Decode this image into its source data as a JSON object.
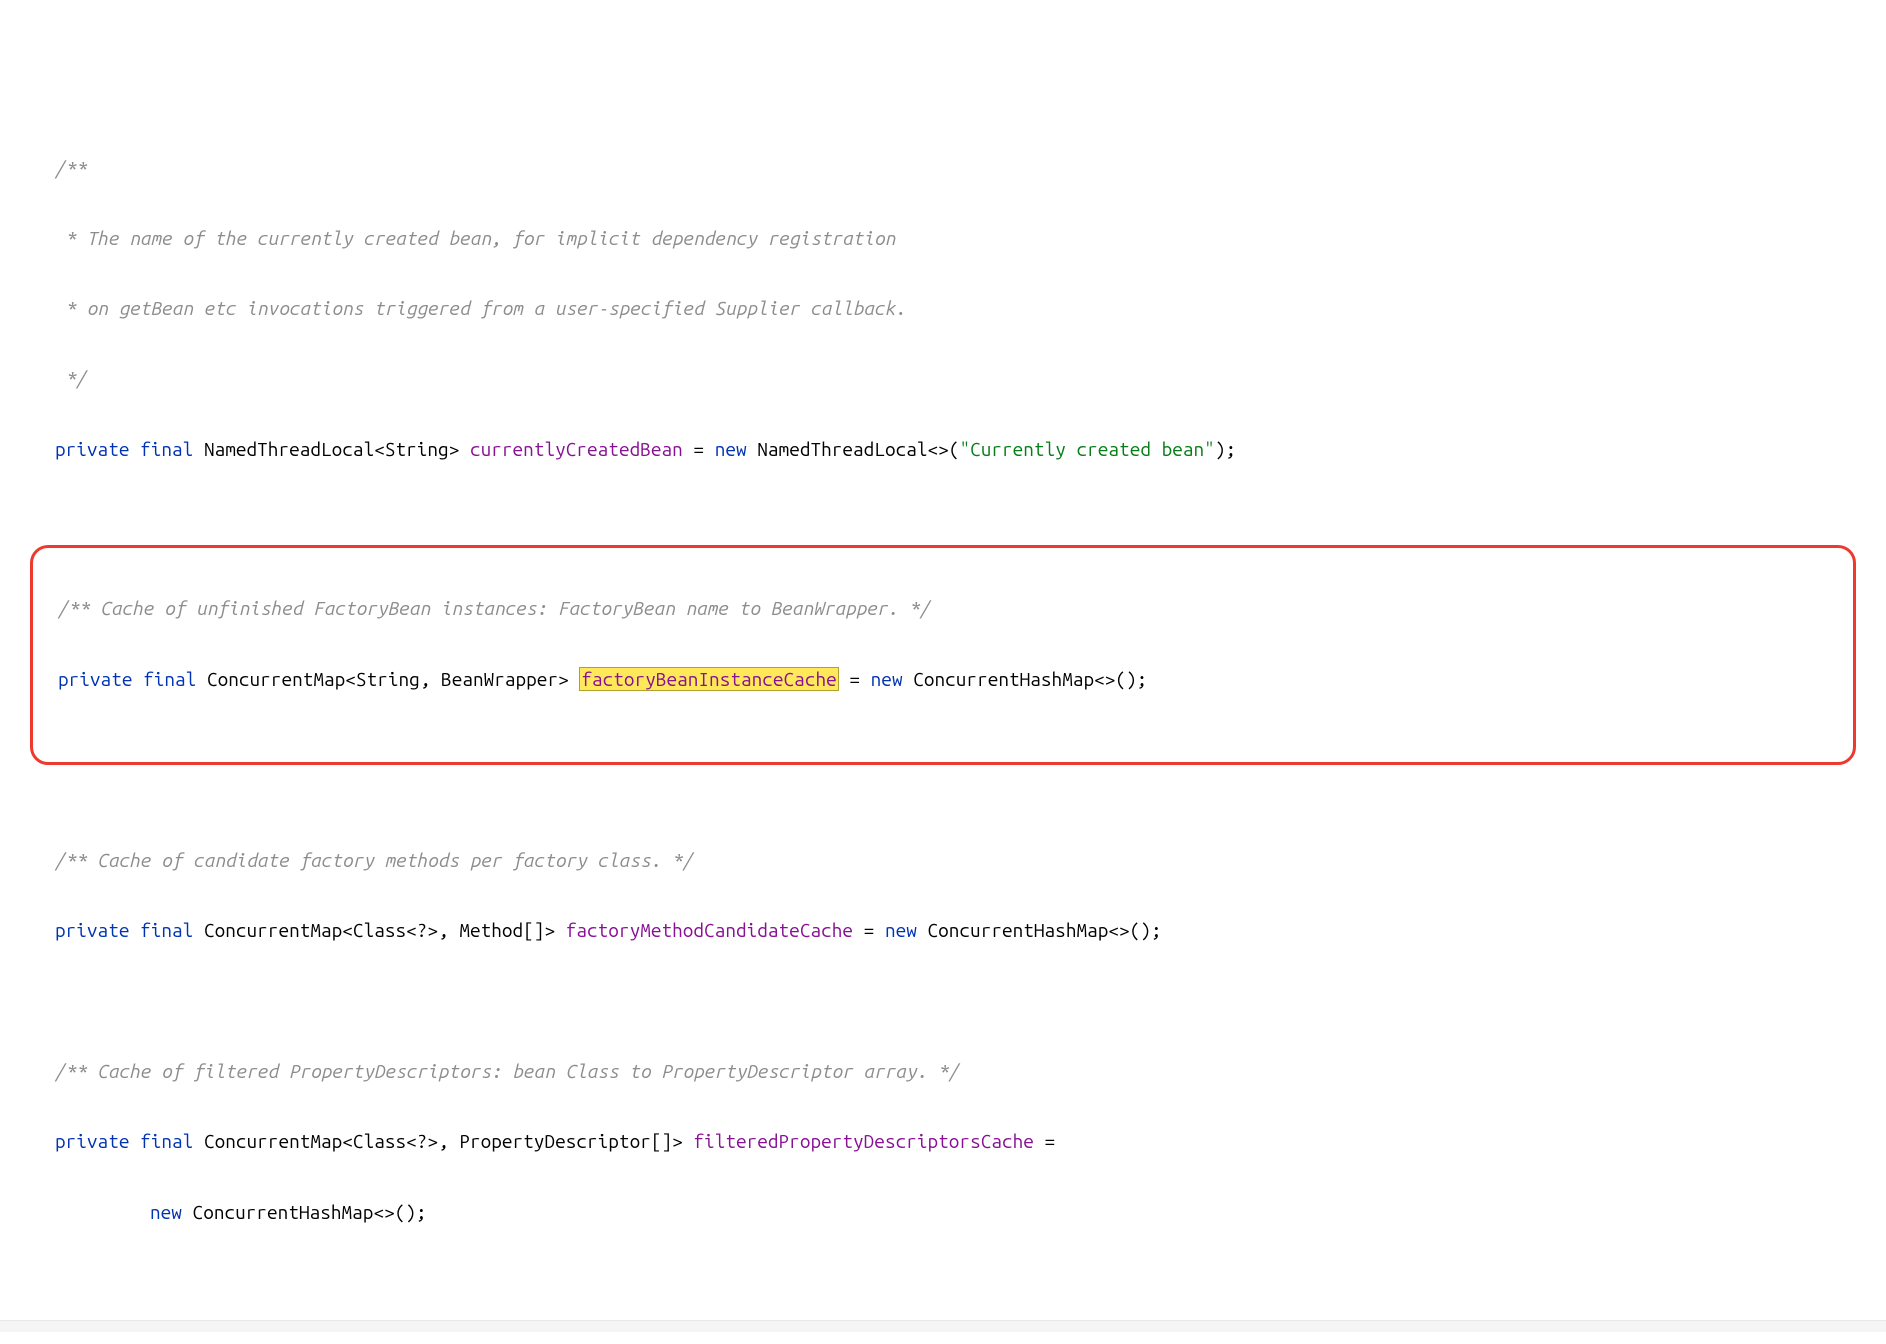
{
  "block1": {
    "c1": "/**",
    "c2": " * The name of the currently created bean, for implicit dependency registration",
    "c3": " * on getBean etc invocations triggered from a user-specified Supplier callback.",
    "c4": " */",
    "kw_private": "private",
    "kw_final": "final",
    "type1": "NamedThreadLocal",
    "gen1": "<String>",
    "field": "currentlyCreatedBean",
    "eq": " = ",
    "kw_new": "new",
    "type2": " NamedThreadLocal<>(",
    "str": "\"Currently created bean\"",
    "end": ");"
  },
  "block2": {
    "c1": "/** Cache of unfinished FactoryBean instances: FactoryBean name to BeanWrapper. */",
    "kw_private": "private",
    "kw_final": "final",
    "type1": " ConcurrentMap<String, BeanWrapper> ",
    "field": "factoryBeanInstanceCache",
    "eq": " = ",
    "kw_new": "new",
    "type2": " ConcurrentHashMap<>();"
  },
  "block3": {
    "c1": "/** Cache of candidate factory methods per factory class. */",
    "kw_private": "private",
    "kw_final": "final",
    "type1": " ConcurrentMap<Class<?>, Method[]> ",
    "field": "factoryMethodCandidateCache",
    "eq": " = ",
    "kw_new": "new",
    "type2": " ConcurrentHashMap<>();"
  },
  "block4": {
    "c1": "/** Cache of filtered PropertyDescriptors: bean Class to PropertyDescriptor array. */",
    "kw_private": "private",
    "kw_final": "final",
    "type1": " ConcurrentMap<Class<?>, PropertyDescriptor[]> ",
    "field": "filteredPropertyDescriptorsCache",
    "eq": " =",
    "kw_new": "new",
    "type2": " ConcurrentHashMap<>();"
  }
}
